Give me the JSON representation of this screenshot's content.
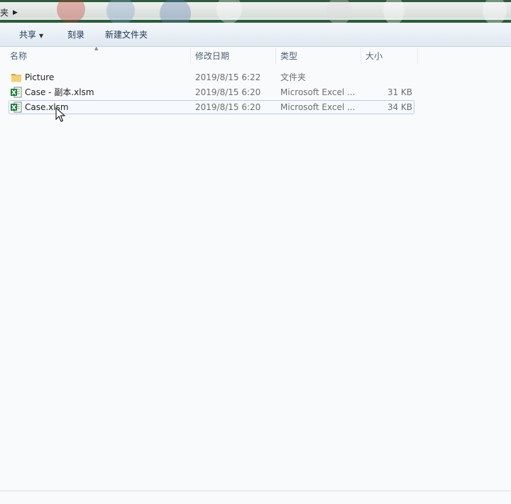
{
  "address": {
    "crumb_text": "夹"
  },
  "toolbar": {
    "share_label": "共享",
    "burn_label": "刻录",
    "new_folder_label": "新建文件夹"
  },
  "columns": {
    "name": "名称",
    "date": "修改日期",
    "type": "类型",
    "size": "大小"
  },
  "files": [
    {
      "name": "Picture",
      "date": "2019/8/15 6:22",
      "type": "文件夹",
      "size": "",
      "icon": "folder-icon"
    },
    {
      "name": "Case - 副本.xlsm",
      "date": "2019/8/15 6:20",
      "type": "Microsoft Excel ...",
      "size": "31 KB",
      "icon": "excel-file-icon"
    },
    {
      "name": "Case.xlsm",
      "date": "2019/8/15 6:20",
      "type": "Microsoft Excel ...",
      "size": "34 KB",
      "icon": "excel-file-icon"
    }
  ],
  "colors": {
    "folder": "#e8c25a",
    "excel": "#1f7a3c",
    "selection_border": "#b6cde8",
    "toolbar_text": "#1e3450"
  }
}
